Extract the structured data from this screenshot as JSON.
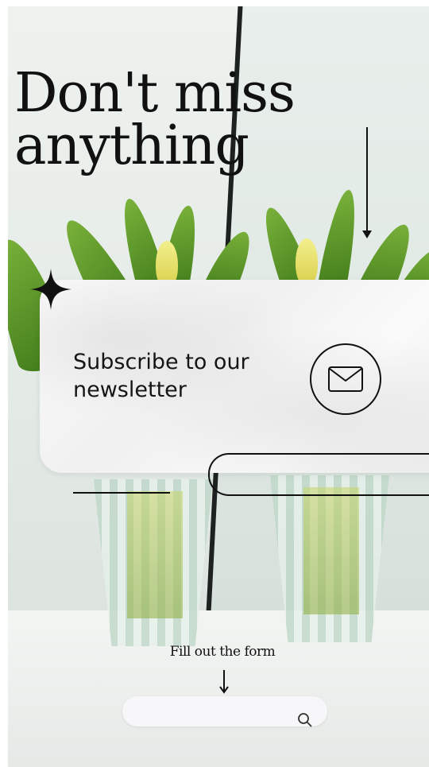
{
  "headline": {
    "line1": "Don't miss",
    "line2": "anything"
  },
  "card": {
    "title": "Subscribe to our newsletter",
    "icon": "envelope-icon"
  },
  "form": {
    "prompt": "Fill out the form",
    "search_placeholder": "",
    "search_icon": "search-icon"
  },
  "decor": {
    "sparkle_icon": "sparkle-icon",
    "arrow_icon": "arrow-down-icon"
  },
  "colors": {
    "ink": "#111111",
    "card": "#f5f5f5",
    "leaf": "#5a9a2a",
    "bud": "#e8e06a"
  }
}
